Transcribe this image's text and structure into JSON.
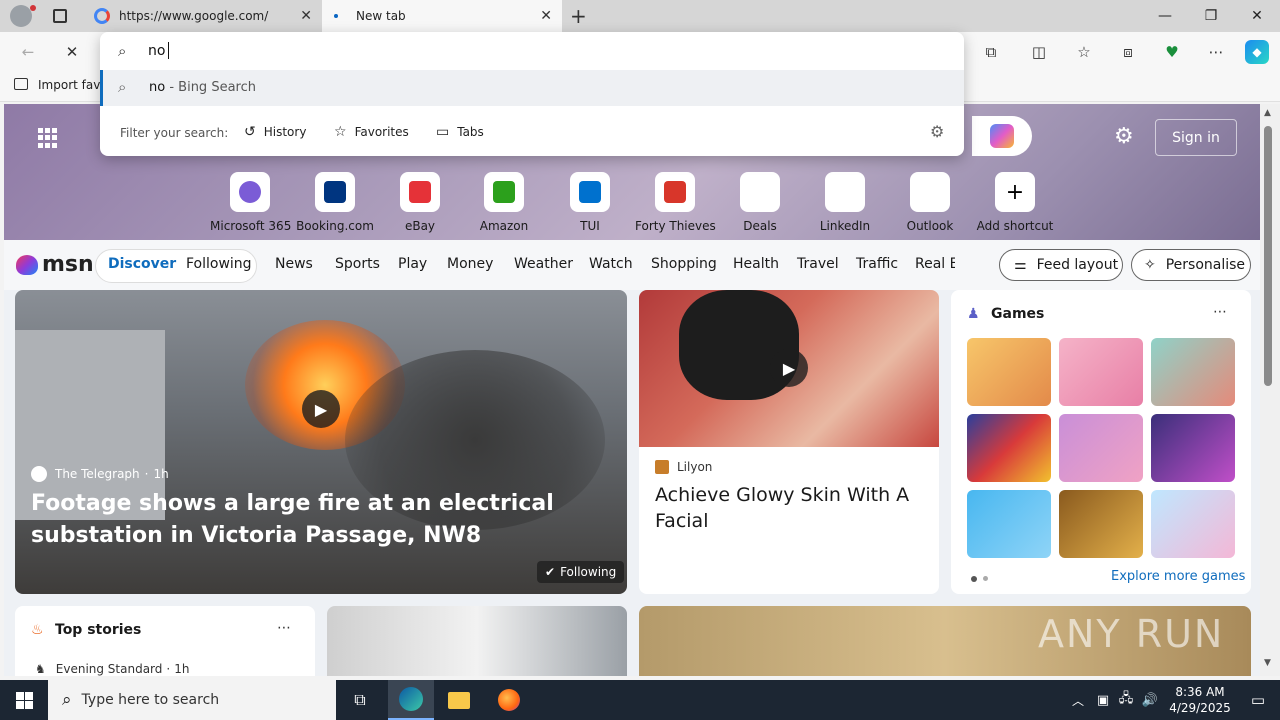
{
  "tabs": [
    {
      "title": "https://www.google.com/",
      "active": false
    },
    {
      "title": "New tab",
      "active": true
    }
  ],
  "omnibox": {
    "query": "no",
    "suggestion_query": "no",
    "suggestion_suffix": " - Bing Search",
    "filter_label": "Filter your search:",
    "filters": [
      "History",
      "Favorites",
      "Tabs"
    ]
  },
  "favorites_bar": {
    "import_label": "Import favo"
  },
  "hero": {
    "sign_in": "Sign in"
  },
  "shortcuts": [
    {
      "label": "Microsoft 365",
      "color": "#7b5cd6"
    },
    {
      "label": "Booking.com",
      "color": "#003580"
    },
    {
      "label": "eBay",
      "color": "#e53238"
    },
    {
      "label": "Amazon",
      "color": "#2ca01c"
    },
    {
      "label": "TUI",
      "color": "#0071ce"
    },
    {
      "label": "Forty Thieves",
      "color": "#d8362a"
    },
    {
      "label": "Deals",
      "color": "#ffffff"
    },
    {
      "label": "LinkedIn",
      "color": "#ffffff"
    },
    {
      "label": "Outlook",
      "color": "#ffffff"
    },
    {
      "label": "Add shortcut",
      "color": "#ffffff"
    }
  ],
  "msn": {
    "logo": "msn",
    "tabs": [
      "Discover",
      "Following"
    ],
    "nav": [
      "News",
      "Sports",
      "Play",
      "Money",
      "Weather",
      "Watch",
      "Shopping",
      "Health",
      "Travel",
      "Traffic",
      "Real E"
    ],
    "feed_layout": "Feed layout",
    "personalise": "Personalise"
  },
  "main_story": {
    "source": "The Telegraph",
    "age": "1h",
    "headline": "Footage shows a large fire at an electrical substation in Victoria Passage, NW8",
    "badge": "Following"
  },
  "side_story": {
    "source": "Lilyon",
    "headline": "Achieve Glowy Skin With A Facial"
  },
  "games": {
    "title": "Games",
    "more": "Explore more games"
  },
  "top_stories": {
    "title": "Top stories",
    "source": "Evening Standard",
    "age": "1h"
  },
  "watermark": "ANY RUN",
  "taskbar": {
    "search_placeholder": "Type here to search",
    "time": "8:36 AM",
    "date": "4/29/2025"
  }
}
